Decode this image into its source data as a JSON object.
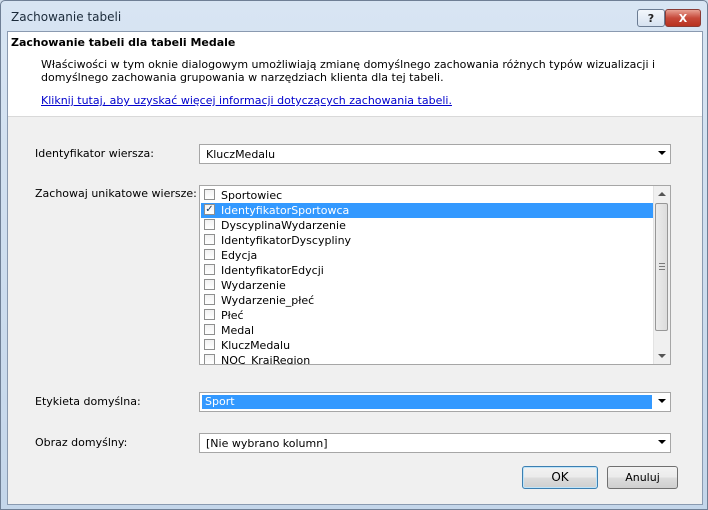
{
  "window": {
    "title": "Zachowanie tabeli",
    "help_label": "?",
    "close_label": "X"
  },
  "header": {
    "title": "Zachowanie tabeli dla tabeli Medale",
    "description": "Właściwości w tym oknie dialogowym umożliwiają zmianę domyślnego zachowania różnych typów wizualizacji i domyślnego zachowania grupowania w narzędziach klienta dla tej tabeli.",
    "link": "Kliknij tutaj, aby uzyskać więcej informacji dotyczących zachowania tabeli."
  },
  "row_identifier": {
    "label": "Identyfikator wiersza:",
    "value": "KluczMedalu"
  },
  "unique_rows": {
    "label": "Zachowaj unikatowe wiersze:",
    "items": [
      {
        "label": "Sportowiec",
        "checked": false
      },
      {
        "label": "IdentyfikatorSportowca",
        "checked": true
      },
      {
        "label": "DyscyplinaWydarzenie",
        "checked": false
      },
      {
        "label": "IdentyfikatorDyscypliny",
        "checked": false
      },
      {
        "label": "Edycja",
        "checked": false
      },
      {
        "label": "IdentyfikatorEdycji",
        "checked": false
      },
      {
        "label": "Wydarzenie",
        "checked": false
      },
      {
        "label": "Wydarzenie_płeć",
        "checked": false
      },
      {
        "label": "Płeć",
        "checked": false
      },
      {
        "label": "Medal",
        "checked": false
      },
      {
        "label": "KluczMedalu",
        "checked": false
      },
      {
        "label": "NOC_KrajRegion",
        "checked": false
      }
    ]
  },
  "default_label": {
    "label": "Etykieta domyślna:",
    "value": "Sport"
  },
  "default_image": {
    "label": "Obraz domyślny:",
    "value": "[Nie wybrano kolumn]"
  },
  "buttons": {
    "ok": "OK",
    "cancel": "Anuluj"
  },
  "colors": {
    "selection": "#3399ff",
    "link": "#0000cc",
    "close_button": "#c7493a"
  },
  "icons": [
    "help-icon",
    "close-icon",
    "checkbox-icon",
    "chevron-down-icon",
    "scroll-up-icon",
    "scroll-down-icon"
  ]
}
